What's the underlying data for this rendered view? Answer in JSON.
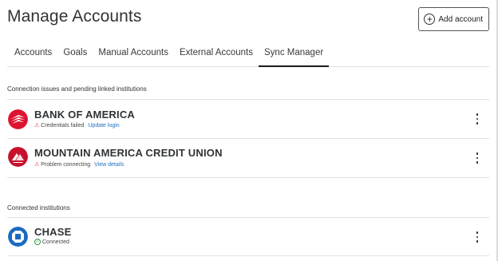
{
  "header": {
    "title": "Manage Accounts",
    "add_button_label": "Add account",
    "add_button_icon": "plus-circle-icon"
  },
  "tabs": [
    {
      "label": "Accounts",
      "active": false
    },
    {
      "label": "Goals",
      "active": false
    },
    {
      "label": "Manual Accounts",
      "active": false
    },
    {
      "label": "External Accounts",
      "active": false
    },
    {
      "label": "Sync Manager",
      "active": true
    }
  ],
  "sections": {
    "issues_label": "Connection issues and pending linked institutions",
    "connected_label": "Connected institutions"
  },
  "institutions": {
    "boa": {
      "name": "BANK OF AMERICA",
      "status": "Credentials failed",
      "action": "Update login",
      "status_icon": "warning-icon"
    },
    "macu": {
      "name": "MOUNTAIN AMERICA CREDIT UNION",
      "status": "Problem connecting",
      "action": "View details",
      "status_icon": "warning-icon"
    },
    "chase": {
      "name": "CHASE",
      "status": "Connected",
      "status_icon": "check-circle-icon"
    }
  },
  "colors": {
    "link": "#1f6fc1",
    "warning": "#d0342c",
    "success": "#2d9b3a",
    "boa_red": "#dc1431",
    "chase_blue": "#1a6bc0"
  }
}
